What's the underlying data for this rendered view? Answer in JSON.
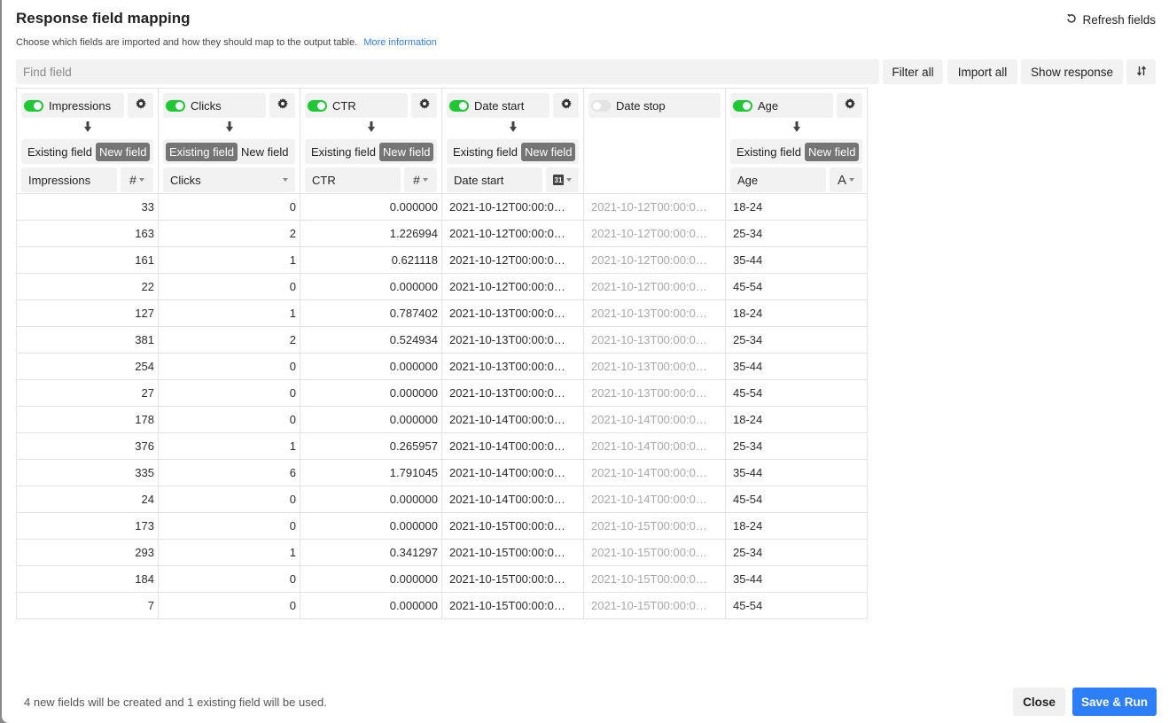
{
  "header": {
    "title": "Response field mapping",
    "refresh_label": "Refresh fields",
    "subtitle": "Choose which fields are imported and how they should map to the output table.",
    "more_info_link": "More information"
  },
  "toolbar": {
    "search_placeholder": "Find field",
    "search_value": "",
    "filter_all": "Filter all",
    "import_all": "Import all",
    "show_response": "Show response",
    "sort_icon": "sort-arrows-icon"
  },
  "columns": [
    {
      "name": "Impressions",
      "enabled": true,
      "mode_existing": "Existing field",
      "mode_new": "New field",
      "selected_mode": "new",
      "target": "Impressions",
      "type_icon": "#",
      "type_name": "number-icon",
      "has_settings": true
    },
    {
      "name": "Clicks",
      "enabled": true,
      "mode_existing": "Existing field",
      "mode_new": "New field",
      "selected_mode": "existing",
      "target": "Clicks",
      "type_icon": "",
      "type_name": "",
      "has_settings": true
    },
    {
      "name": "CTR",
      "enabled": true,
      "mode_existing": "Existing field",
      "mode_new": "New field",
      "selected_mode": "new",
      "target": "CTR",
      "type_icon": "#",
      "type_name": "number-icon",
      "has_settings": true
    },
    {
      "name": "Date start",
      "enabled": true,
      "mode_existing": "Existing field",
      "mode_new": "New field",
      "selected_mode": "new",
      "target": "Date start",
      "type_icon": "31",
      "type_name": "calendar-icon",
      "has_settings": true
    },
    {
      "name": "Date stop",
      "enabled": false,
      "has_settings": false
    },
    {
      "name": "Age",
      "enabled": true,
      "mode_existing": "Existing field",
      "mode_new": "New field",
      "selected_mode": "new",
      "target": "Age",
      "type_icon": "A",
      "type_name": "text-icon",
      "has_settings": true
    }
  ],
  "rows": [
    [
      "33",
      "0",
      "0.000000",
      "2021-10-12T00:00:0…",
      "2021-10-12T00:00:0…",
      "18-24"
    ],
    [
      "163",
      "2",
      "1.226994",
      "2021-10-12T00:00:0…",
      "2021-10-12T00:00:0…",
      "25-34"
    ],
    [
      "161",
      "1",
      "0.621118",
      "2021-10-12T00:00:0…",
      "2021-10-12T00:00:0…",
      "35-44"
    ],
    [
      "22",
      "0",
      "0.000000",
      "2021-10-12T00:00:0…",
      "2021-10-12T00:00:0…",
      "45-54"
    ],
    [
      "127",
      "1",
      "0.787402",
      "2021-10-13T00:00:0…",
      "2021-10-13T00:00:0…",
      "18-24"
    ],
    [
      "381",
      "2",
      "0.524934",
      "2021-10-13T00:00:0…",
      "2021-10-13T00:00:0…",
      "25-34"
    ],
    [
      "254",
      "0",
      "0.000000",
      "2021-10-13T00:00:0…",
      "2021-10-13T00:00:0…",
      "35-44"
    ],
    [
      "27",
      "0",
      "0.000000",
      "2021-10-13T00:00:0…",
      "2021-10-13T00:00:0…",
      "45-54"
    ],
    [
      "178",
      "0",
      "0.000000",
      "2021-10-14T00:00:0…",
      "2021-10-14T00:00:0…",
      "18-24"
    ],
    [
      "376",
      "1",
      "0.265957",
      "2021-10-14T00:00:0…",
      "2021-10-14T00:00:0…",
      "25-34"
    ],
    [
      "335",
      "6",
      "1.791045",
      "2021-10-14T00:00:0…",
      "2021-10-14T00:00:0…",
      "35-44"
    ],
    [
      "24",
      "0",
      "0.000000",
      "2021-10-14T00:00:0…",
      "2021-10-14T00:00:0…",
      "45-54"
    ],
    [
      "173",
      "0",
      "0.000000",
      "2021-10-15T00:00:0…",
      "2021-10-15T00:00:0…",
      "18-24"
    ],
    [
      "293",
      "1",
      "0.341297",
      "2021-10-15T00:00:0…",
      "2021-10-15T00:00:0…",
      "25-34"
    ],
    [
      "184",
      "0",
      "0.000000",
      "2021-10-15T00:00:0…",
      "2021-10-15T00:00:0…",
      "35-44"
    ],
    [
      "7",
      "0",
      "0.000000",
      "2021-10-15T00:00:0…",
      "2021-10-15T00:00:0…",
      "45-54"
    ]
  ],
  "footer": {
    "summary": "4 new fields will be created and 1 existing field will be used.",
    "close_label": "Close",
    "save_label": "Save & Run"
  },
  "colors": {
    "accent": "#2d7ff9",
    "toggle_on": "#20c933",
    "segment_active": "#757575"
  }
}
